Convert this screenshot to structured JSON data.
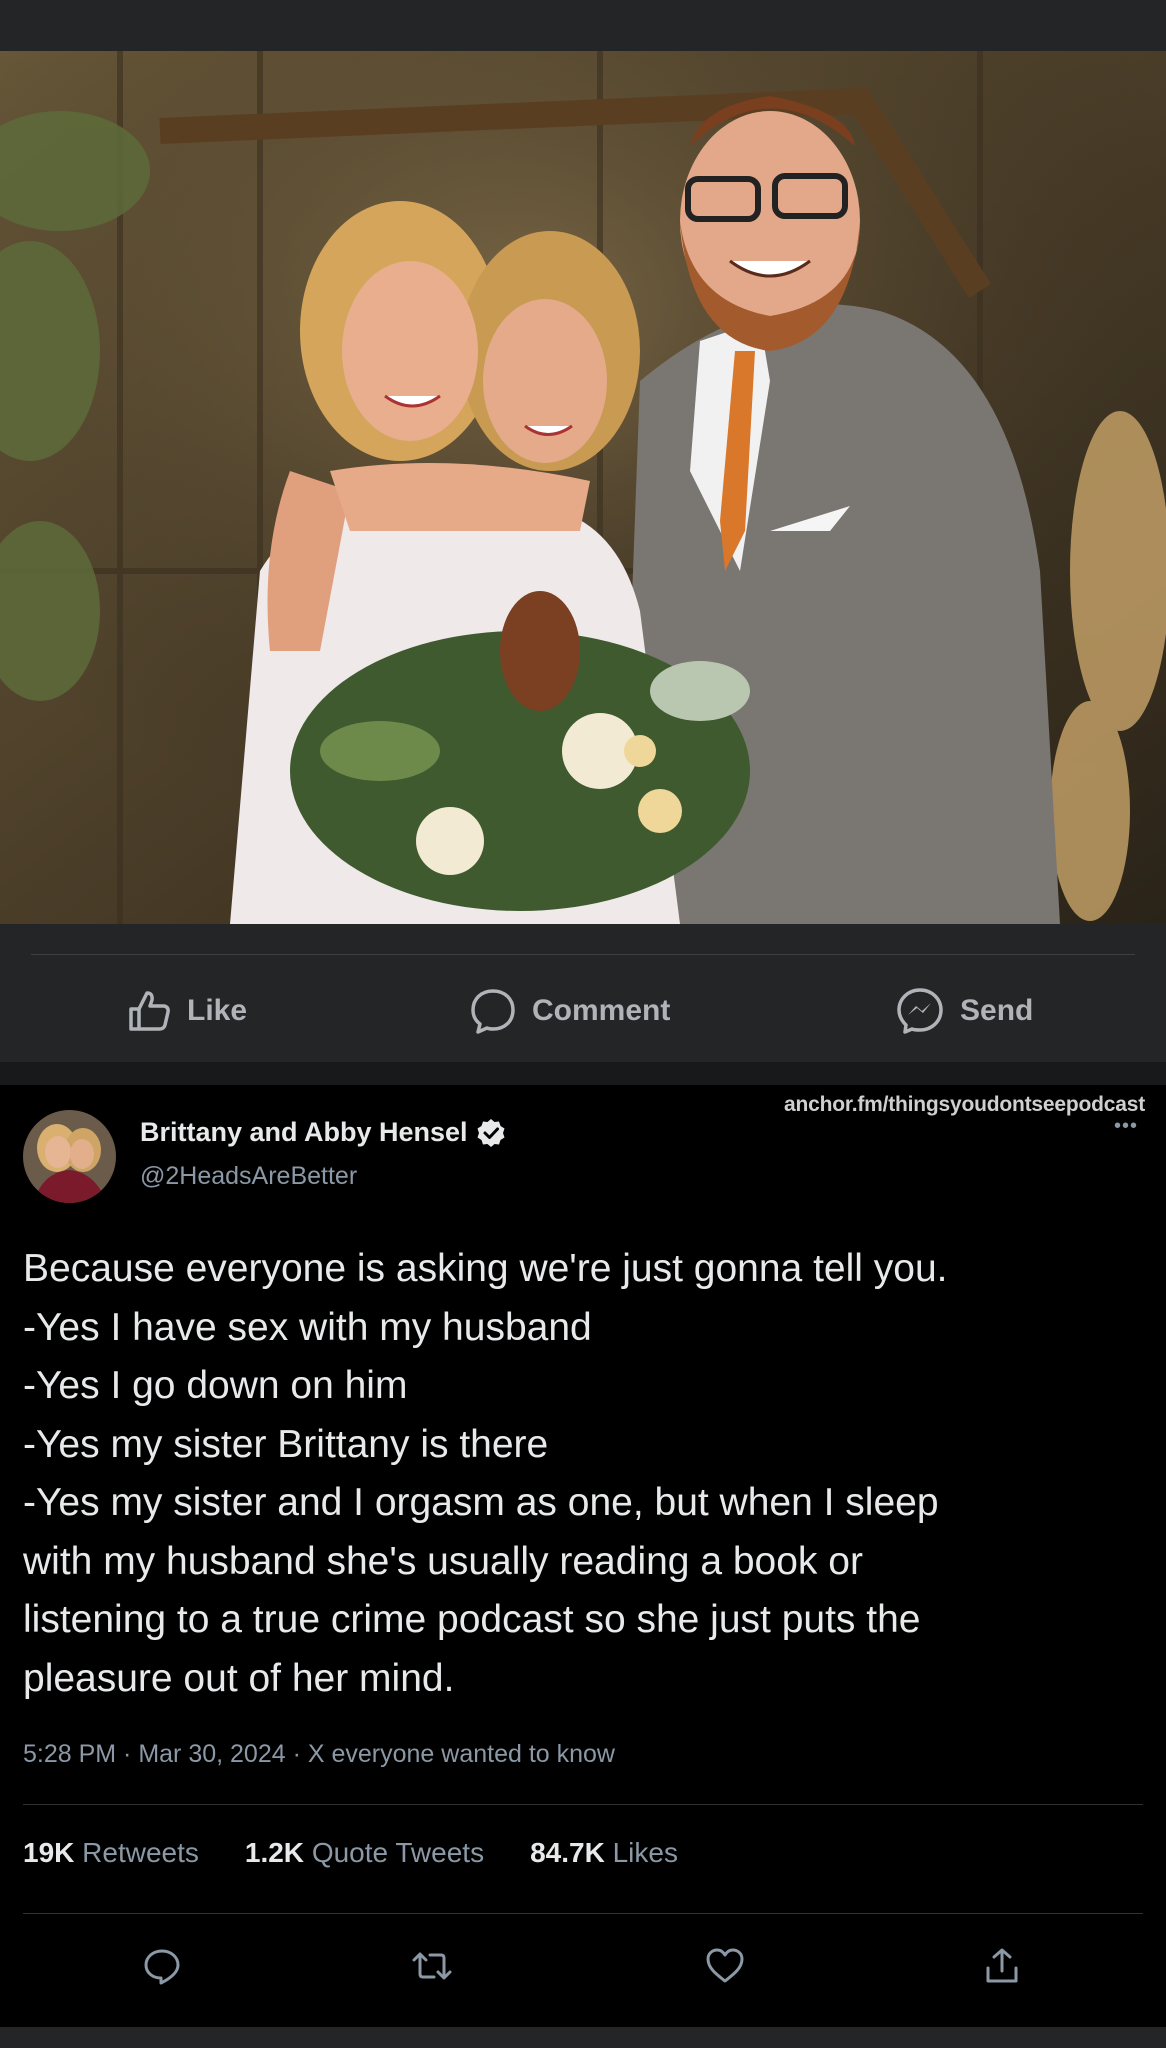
{
  "post": {
    "actions": {
      "like": "Like",
      "comment": "Comment",
      "send": "Send"
    },
    "icons": {
      "like": "thumbs-up-icon",
      "comment": "speech-bubble-icon",
      "send": "messenger-icon"
    }
  },
  "tweet": {
    "watermark": "anchor.fm/thingsyoudontseepodcast",
    "more": "•••",
    "author": {
      "name": "Brittany and Abby Hensel",
      "handle": "@2HeadsAreBetter",
      "verified": true
    },
    "text_lines": [
      "Because everyone is asking we're just gonna tell you.",
      "-Yes I have sex with my husband",
      "-Yes I go down on him",
      "-Yes my sister Brittany is there",
      "-Yes my sister and I orgasm as one, but when I sleep",
      "with my husband she's usually reading a book or",
      "listening to a true crime podcast so she just puts the",
      "pleasure out of her mind."
    ],
    "meta": "5:28 PM · Mar 30, 2024 · X everyone wanted to know",
    "stats": [
      {
        "count": "19K",
        "label": "Retweets"
      },
      {
        "count": "1.2K",
        "label": "Quote Tweets"
      },
      {
        "count": "84.7K",
        "label": "Likes"
      }
    ],
    "action_icons": [
      "reply-icon",
      "retweet-icon",
      "heart-icon",
      "share-icon"
    ]
  },
  "colors": {
    "fb_background": "#242526",
    "fb_text": "#b0b3b8",
    "tweet_background": "#000000",
    "tweet_text": "#e7e9ea",
    "tweet_secondary": "#8b98a5",
    "divider": "#2f3336"
  }
}
